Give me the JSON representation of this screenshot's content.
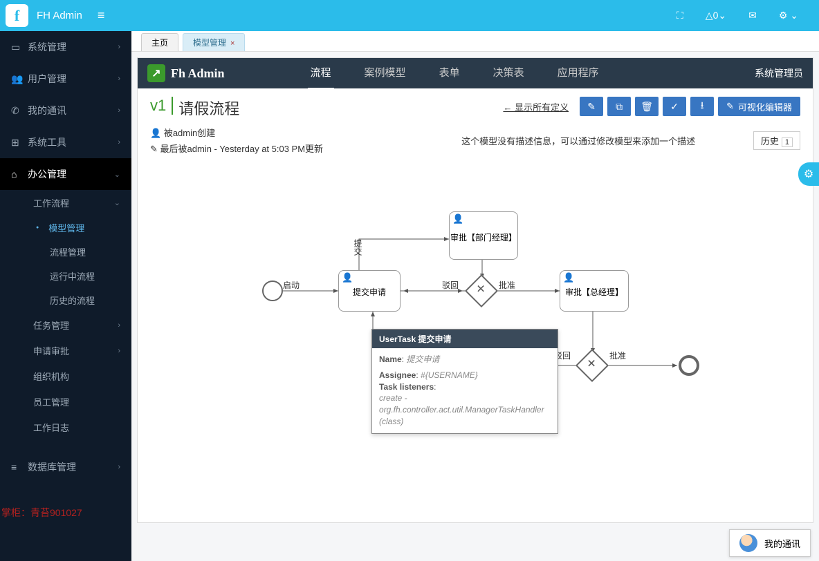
{
  "brand": "FH Admin",
  "top_icons": {
    "bell": "△0",
    "bell_chev": "⌄"
  },
  "sidebar": {
    "items": [
      {
        "icon": "▭",
        "label": "系统管理"
      },
      {
        "icon": "👥",
        "label": "用户管理"
      },
      {
        "icon": "✆",
        "label": "我的通讯"
      },
      {
        "icon": "⊞",
        "label": "系统工具"
      }
    ],
    "active": {
      "icon": "⌂",
      "label": "办公管理"
    },
    "sub": {
      "workflow": "工作流程",
      "children": [
        "模型管理",
        "流程管理",
        "运行中流程",
        "历史的流程"
      ],
      "others": [
        "任务管理",
        "申请审批",
        "组织机构",
        "员工管理",
        "工作日志"
      ]
    },
    "db": {
      "icon": "≡",
      "label": "数据库管理"
    },
    "footer": "掌柜：青苔901027"
  },
  "tabs": {
    "home": "主页",
    "active": "模型管理"
  },
  "inner": {
    "logo": "Fh Admin",
    "nav": [
      "流程",
      "案例模型",
      "表单",
      "决策表",
      "应用程序"
    ],
    "user": "系统管理员"
  },
  "detail": {
    "version": "v1",
    "name": "请假流程",
    "show_all": "← 显示所有定义",
    "visual_editor": "可视化编辑器",
    "created": "被admin创建",
    "updated": "最后被admin - Yesterday at 5:03 PM更新",
    "desc": "这个模型没有描述信息，可以通过修改模型来添加一个描述",
    "history": "历史",
    "history_n": "1"
  },
  "diagram": {
    "start": "启动",
    "n1": "提交申请",
    "n2": "审批【部门经理】",
    "n3": "审批【总经理】",
    "e_submit": "提交",
    "e_reject": "驳回",
    "e_approve": "批准",
    "e_reject2": "驳回",
    "e_approve2": "批准"
  },
  "tooltip": {
    "title": "UserTask 提交申请",
    "name_k": "Name",
    "name_v": "提交申请",
    "assignee_k": "Assignee",
    "assignee_v": "#{USERNAME}",
    "tl_k": "Task listeners",
    "tl_v": "create - org.fh.controller.act.util.ManagerTaskHandler (class)"
  },
  "chat": "我的通讯"
}
